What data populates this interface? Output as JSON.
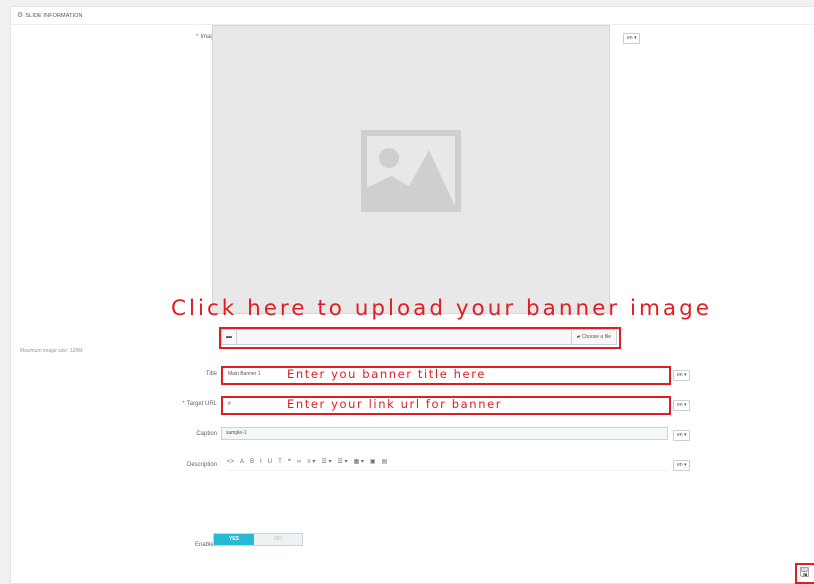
{
  "panel": {
    "title": "SLIDE INFORMATION",
    "title_icon": "cogs-icon"
  },
  "form": {
    "image": {
      "label": "Image",
      "required_mark": "*",
      "lang": "en ▾",
      "placeholder_icon": "image-placeholder-icon",
      "file_icon": "file-icon",
      "choose_label": "Choose a file",
      "max_size_note": "Maximum image size: 128M."
    },
    "title": {
      "label": "Title",
      "value": "Main Banner 1",
      "lang": "en ▾"
    },
    "target_url": {
      "label": "Target URL",
      "required_mark": "*",
      "value": "#",
      "lang": "en ▾"
    },
    "caption": {
      "label": "Caption",
      "value": "sample-1",
      "lang": "en ▾"
    },
    "description": {
      "label": "Description",
      "lang": "en ▾"
    },
    "enabled": {
      "label": "Enabled",
      "yes": "YES",
      "no": "NO",
      "value": "YES"
    }
  },
  "toolbar": [
    {
      "name": "source-icon",
      "glyph": "<>"
    },
    {
      "name": "text-color-icon",
      "glyph": "A"
    },
    {
      "name": "bold-icon",
      "glyph": "B"
    },
    {
      "name": "italic-icon",
      "glyph": "I"
    },
    {
      "name": "underline-icon",
      "glyph": "U"
    },
    {
      "name": "strikethrough-icon",
      "glyph": "T"
    },
    {
      "name": "blockquote-icon",
      "glyph": "❝"
    },
    {
      "name": "link-icon",
      "glyph": "∞"
    },
    {
      "name": "align-icon",
      "glyph": "≡ ▾"
    },
    {
      "name": "bullet-list-icon",
      "glyph": "☰ ▾"
    },
    {
      "name": "numbered-list-icon",
      "glyph": "☰ ▾"
    },
    {
      "name": "table-icon",
      "glyph": "▦ ▾"
    },
    {
      "name": "image-icon",
      "glyph": "▣"
    },
    {
      "name": "media-icon",
      "glyph": "▤"
    }
  ],
  "annotations": {
    "upload": "Click here to upload your banner image",
    "title": "Enter you banner title here",
    "url": "Enter your link url for banner"
  },
  "save_icon": "save-icon",
  "colors": {
    "accent": "#25b9d7",
    "annotation": "#e11d24",
    "required": "#e23c3c"
  }
}
